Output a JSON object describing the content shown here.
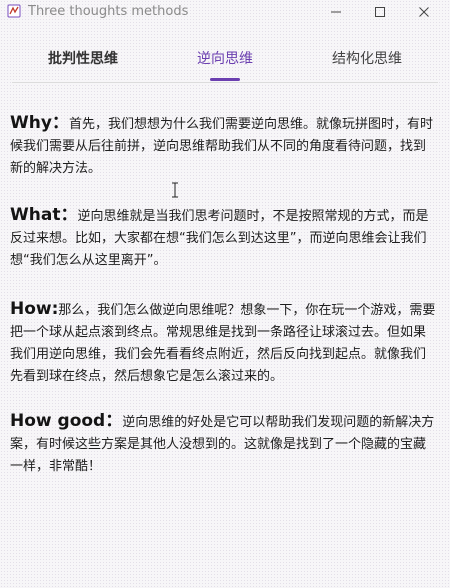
{
  "window": {
    "title": "Three thoughts methods",
    "icons": [
      "app-icon",
      "minimize-icon",
      "maximize-icon",
      "close-icon"
    ]
  },
  "tabs": [
    {
      "label": "批判性思维",
      "selected": false
    },
    {
      "label": "逆向思维",
      "selected": true
    },
    {
      "label": "结构化思维",
      "selected": false
    }
  ],
  "accent_color": "#6b3fb0",
  "paragraphs": [
    {
      "heading": "Why：",
      "body": "首先，我们想想为什么我们需要逆向思维。就像玩拼图时，有时候我们需要从后往前拼，逆向思维帮助我们从不同的角度看待问题，找到新的解决方法。"
    },
    {
      "heading": "What：",
      "body": "逆向思维就是当我们思考问题时，不是按照常规的方式，而是反过来想。比如，大家都在想“我们怎么到达这里”，而逆向思维会让我们想“我们怎么从这里离开”。"
    },
    {
      "heading": "How:",
      "body": "那么，我们怎么做逆向思维呢？想象一下，你在玩一个游戏，需要把一个球从起点滚到终点。常规思维是找到一条路径让球滚过去。但如果我们用逆向思维，我们会先看看终点附近，然后反向找到起点。就像我们先看到球在终点，然后想象它是怎么滚过来的。"
    },
    {
      "heading": "How good：",
      "body": "逆向思维的好处是它可以帮助我们发现问题的新解决方案，有时候这些方案是其他人没想到的。这就像是找到了一个隐藏的宝藏一样，非常酷！"
    }
  ]
}
